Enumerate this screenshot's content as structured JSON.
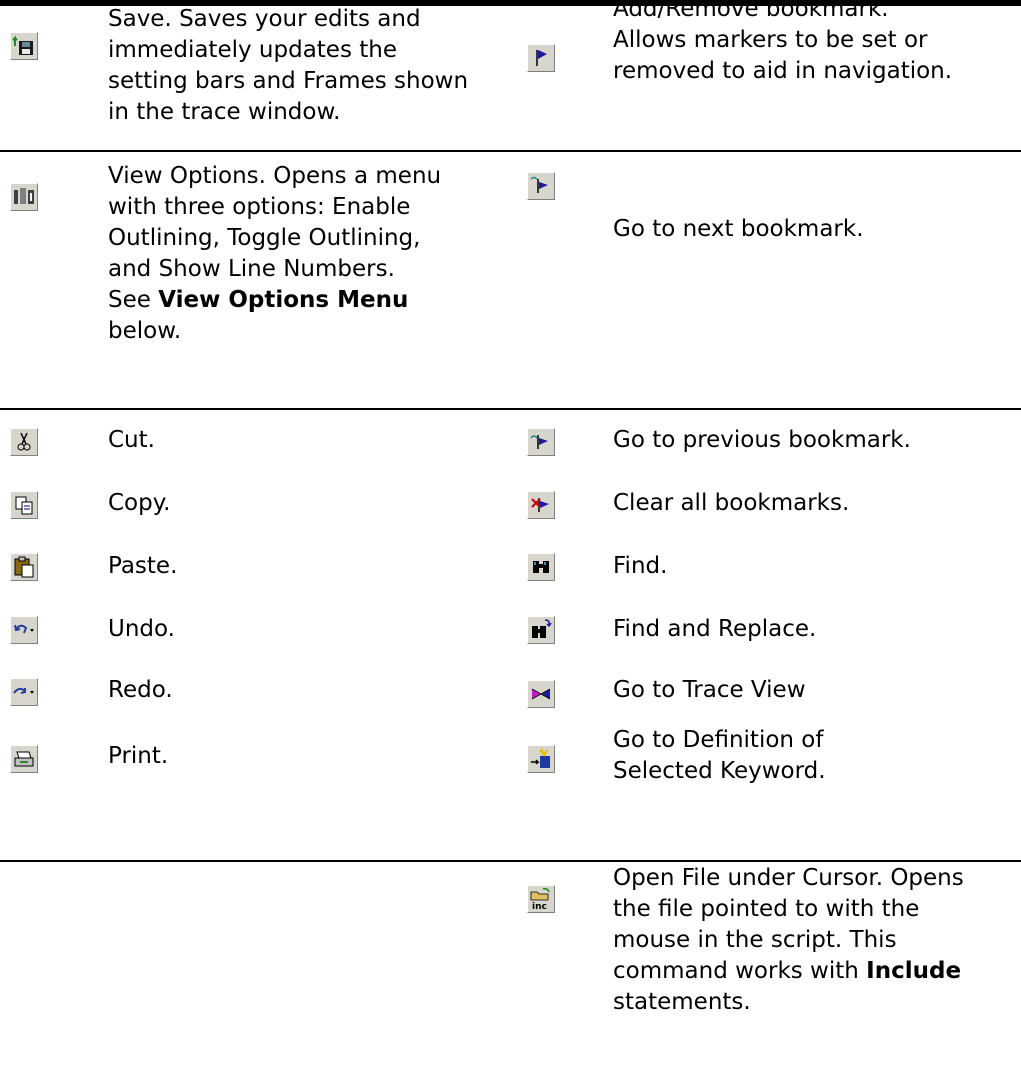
{
  "left": [
    {
      "icon": "save-icon",
      "lines": [
        "Save. Saves your edits and",
        "immediately updates the",
        "setting bars and Frames shown",
        "in the trace window."
      ]
    },
    {
      "icon": "view-options-icon",
      "lines": [
        "View Options. Opens a menu",
        "with three options: Enable",
        "Outlining, Toggle Outlining,",
        "and Show Line Numbers."
      ],
      "see_prefix": "See ",
      "see_link": "View Options Menu",
      "see_suffix": "below."
    },
    {
      "icon": "cut-icon",
      "text": "Cut."
    },
    {
      "icon": "copy-icon",
      "text": "Copy."
    },
    {
      "icon": "paste-icon",
      "text": "Paste."
    },
    {
      "icon": "undo-icon",
      "text": "Undo."
    },
    {
      "icon": "redo-icon",
      "text": "Redo."
    },
    {
      "icon": "print-icon",
      "text": "Print."
    }
  ],
  "right": [
    {
      "icon": "bookmark-flag-icon",
      "lines": [
        "Add/Remove bookmark.",
        "Allows markers to be set or",
        "removed to aid in navigation."
      ]
    },
    {
      "icon": "next-bookmark-icon",
      "text": "Go to next bookmark."
    },
    {
      "icon": "previous-bookmark-icon",
      "text": "Go to previous bookmark."
    },
    {
      "icon": "clear-bookmarks-icon",
      "text": "Clear all bookmarks."
    },
    {
      "icon": "binoculars-icon",
      "text": "Find."
    },
    {
      "icon": "find-replace-icon",
      "text": "Find and Replace."
    },
    {
      "icon": "trace-view-icon",
      "text": "Go to Trace View"
    },
    {
      "icon": "goto-definition-icon",
      "lines": [
        "Go to Definition of",
        "Selected Keyword."
      ]
    },
    {
      "icon": "open-include-icon",
      "lines": [
        "Open File under Cursor. Opens",
        "the file pointed to with the",
        "mouse in the script. This"
      ],
      "include_prefix": "command works with ",
      "include_word": "Include",
      "include_suffix": "statements.",
      "icon_label": "inc"
    }
  ]
}
